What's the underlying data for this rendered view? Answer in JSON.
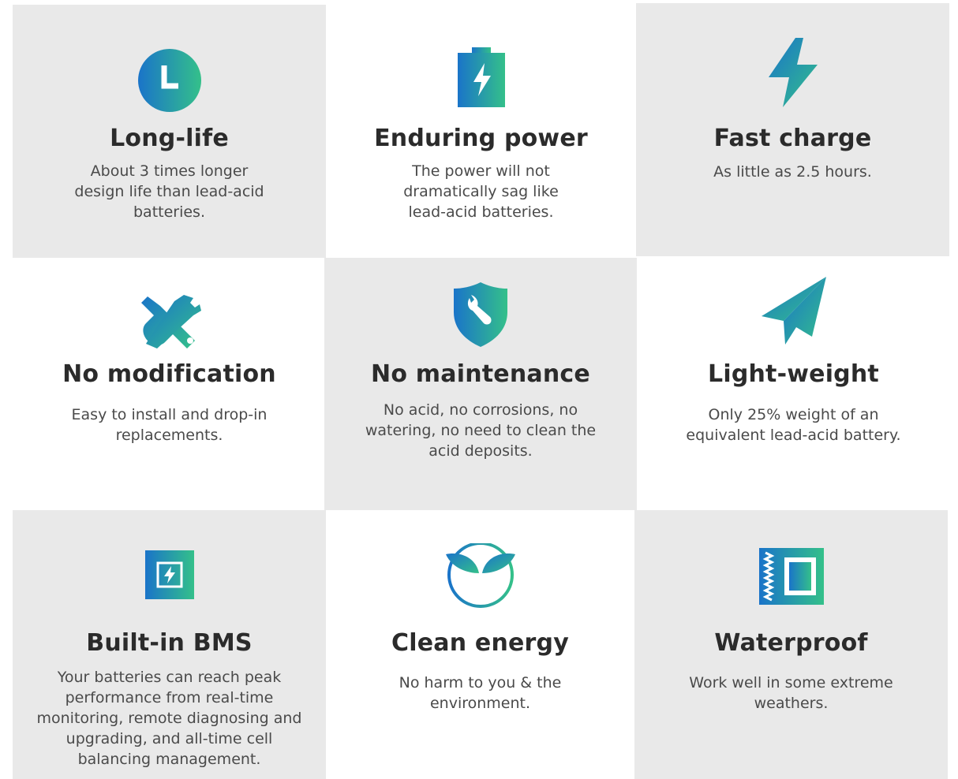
{
  "colors": {
    "gradient_start": "#1a74c9",
    "gradient_end": "#34c08a",
    "tile_gray": "#e9e9e9",
    "title_text": "#2b2b2b",
    "body_text": "#4a4a4a"
  },
  "features": [
    {
      "icon": "clock-icon",
      "title": "Long-life",
      "description": "About 3 times longer design life than lead-acid batteries."
    },
    {
      "icon": "battery-icon",
      "title": "Enduring power",
      "description": "The power will not dramatically sag like lead-acid batteries."
    },
    {
      "icon": "lightning-icon",
      "title": "Fast charge",
      "description": "As little as 2.5 hours."
    },
    {
      "icon": "tools-icon",
      "title": "No modification",
      "description": "Easy to install and drop-in replacements."
    },
    {
      "icon": "shield-wrench-icon",
      "title": "No maintenance",
      "description": "No acid, no corrosions, no watering, no need to clean the acid deposits."
    },
    {
      "icon": "paper-plane-icon",
      "title": "Light-weight",
      "description": "Only 25% weight of an equivalent lead-acid battery."
    },
    {
      "icon": "chip-icon",
      "title": "Built-in BMS",
      "description": "Your batteries can reach peak performance from real-time monitoring, remote diagnosing and upgrading, and all-time cell balancing management."
    },
    {
      "icon": "sprout-icon",
      "title": "Clean energy",
      "description": "No harm to you & the environment."
    },
    {
      "icon": "waterproof-icon",
      "title": "Waterproof",
      "description": "Work well in some extreme weathers."
    }
  ]
}
